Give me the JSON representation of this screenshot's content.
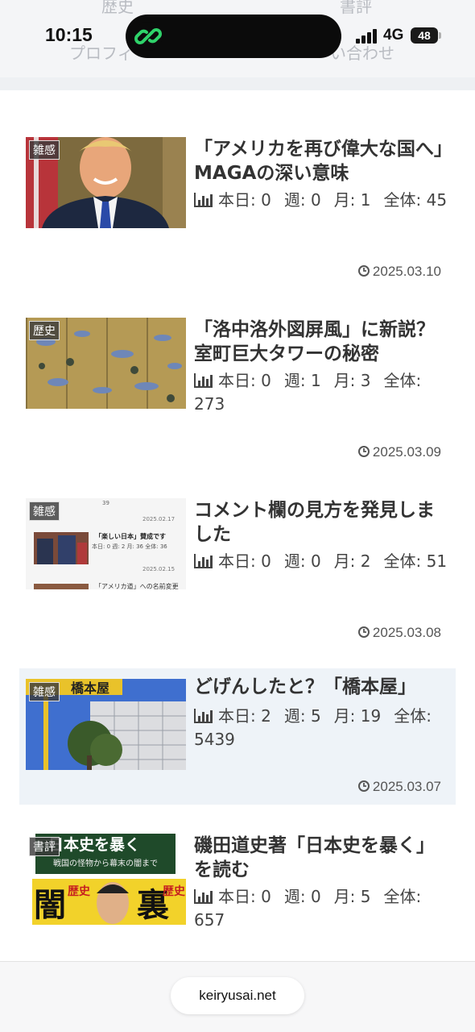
{
  "status_bar": {
    "time": "10:15",
    "network": "4G",
    "battery": "48"
  },
  "nav": {
    "items": [
      "歴史",
      "書評",
      "プロフィ",
      "い合わせ"
    ]
  },
  "stat_labels": {
    "today": "本日:",
    "week": "週:",
    "month": "月:",
    "total": "全体:"
  },
  "articles": [
    {
      "category": "雑感",
      "title": "「アメリカを再び偉大な国へ」MAGAの深い意味",
      "today": "0",
      "week": "0",
      "month": "1",
      "total": "45",
      "date": "2025.03.10"
    },
    {
      "category": "歴史",
      "title": "「洛中洛外図屏風」に新説？室町巨大タワーの秘密",
      "today": "0",
      "week": "1",
      "month": "3",
      "total": "273",
      "date": "2025.03.09"
    },
    {
      "category": "雑感",
      "title": "コメント欄の見方を発見しました",
      "today": "0",
      "week": "0",
      "month": "2",
      "total": "51",
      "date": "2025.03.08",
      "thumb_text": {
        "count": "39",
        "date1": "2025.02.17",
        "headline": "「楽しい日本」賛成です",
        "stats": "本日: 0 週: 2 月: 36 全体: 36",
        "date2": "2025.02.15",
        "cut": "「アメリカ道」への名前変更"
      }
    },
    {
      "category": "雑感",
      "title": "どげんしたと？「橋本屋」",
      "today": "2",
      "week": "5",
      "month": "19",
      "total": "5439",
      "date": "2025.03.07",
      "thumb_text": {
        "sign": "橋本屋"
      }
    },
    {
      "category": "書評",
      "title": "磯田道史著「日本史を暴く」を読む",
      "today": "0",
      "week": "0",
      "month": "5",
      "total": "657",
      "thumb_text": {
        "banner": "日本史を暴く",
        "subtitle": "戦国の怪物から幕末の闇まで",
        "left": "闇",
        "left_small": "歴史",
        "right": "裏",
        "right_small": "歴史"
      }
    }
  ],
  "browser": {
    "url": "keiryusai.net"
  },
  "colors": {
    "highlight_row": "#eef3f8",
    "category_badge": "#3c3c3c"
  }
}
